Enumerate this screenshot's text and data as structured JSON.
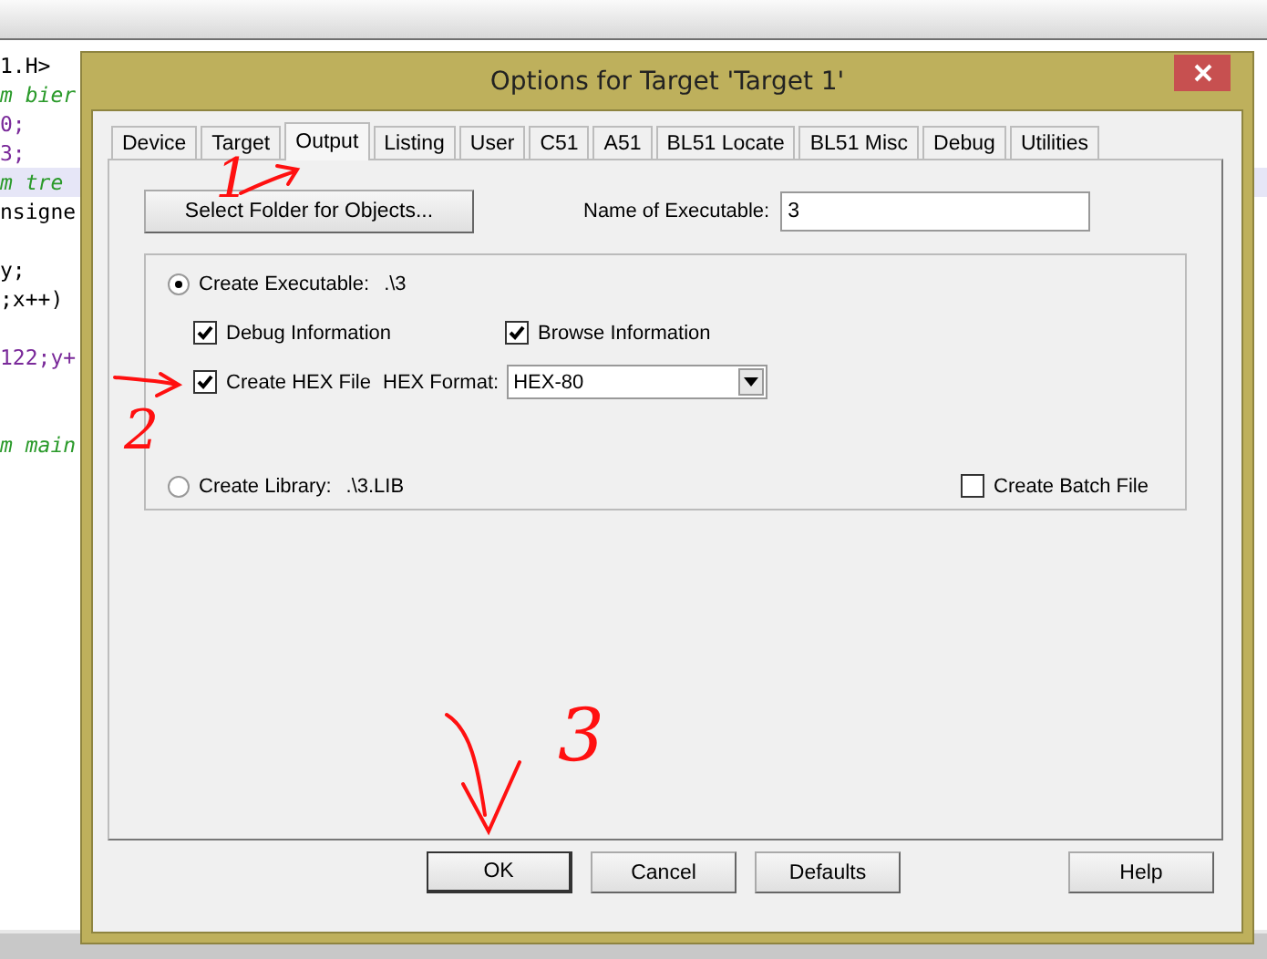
{
  "editor": {
    "lines": [
      {
        "kind": "code",
        "text": "1.H>",
        "highlighted": false
      },
      {
        "kind": "comment",
        "text": "m bier",
        "highlighted": false
      },
      {
        "kind": "number",
        "text": "0;",
        "highlighted": false
      },
      {
        "kind": "number",
        "text": "3;",
        "highlighted": false
      },
      {
        "kind": "comment",
        "text": "m tre",
        "highlighted": true
      },
      {
        "kind": "code",
        "text": "nsigne",
        "highlighted": false
      },
      {
        "kind": "blank",
        "highlighted": false
      },
      {
        "kind": "code",
        "text": "y;",
        "highlighted": false
      },
      {
        "kind": "code",
        "text": ";x++)",
        "highlighted": false
      },
      {
        "kind": "blank",
        "highlighted": false
      },
      {
        "kind": "number",
        "text": "122;y+",
        "highlighted": false
      },
      {
        "kind": "blank",
        "highlighted": false
      },
      {
        "kind": "blank",
        "highlighted": false
      },
      {
        "kind": "comment",
        "text": "m main",
        "highlighted": false
      }
    ]
  },
  "dialog": {
    "title": "Options for Target 'Target 1'",
    "tabs": [
      {
        "label": "Device",
        "selected": false
      },
      {
        "label": "Target",
        "selected": false
      },
      {
        "label": "Output",
        "selected": true
      },
      {
        "label": "Listing",
        "selected": false
      },
      {
        "label": "User",
        "selected": false
      },
      {
        "label": "C51",
        "selected": false
      },
      {
        "label": "A51",
        "selected": false
      },
      {
        "label": "BL51 Locate",
        "selected": false
      },
      {
        "label": "BL51 Misc",
        "selected": false
      },
      {
        "label": "Debug",
        "selected": false
      },
      {
        "label": "Utilities",
        "selected": false
      }
    ],
    "select_folder_button": "Select Folder for Objects...",
    "name_of_executable": {
      "label": "Name of Executable:",
      "value": "3"
    },
    "create_executable": {
      "label": "Create Executable:",
      "path": ".\\3",
      "selected": true
    },
    "debug_information": {
      "label": "Debug Information",
      "checked": true
    },
    "browse_information": {
      "label": "Browse Information",
      "checked": true
    },
    "create_hex_file": {
      "label": "Create HEX File",
      "checked": true
    },
    "hex_format": {
      "label": "HEX Format:",
      "value": "HEX-80"
    },
    "create_library": {
      "label": "Create Library:",
      "path": ".\\3.LIB",
      "selected": false
    },
    "create_batch_file": {
      "label": "Create Batch File",
      "checked": false
    },
    "buttons": [
      {
        "label": "OK",
        "default": true
      },
      {
        "label": "Cancel",
        "default": false
      },
      {
        "label": "Defaults",
        "default": false
      },
      {
        "label": "Help",
        "default": false
      }
    ]
  },
  "annotations": [
    {
      "text": "1"
    },
    {
      "text": "2"
    },
    {
      "text": "3"
    }
  ]
}
